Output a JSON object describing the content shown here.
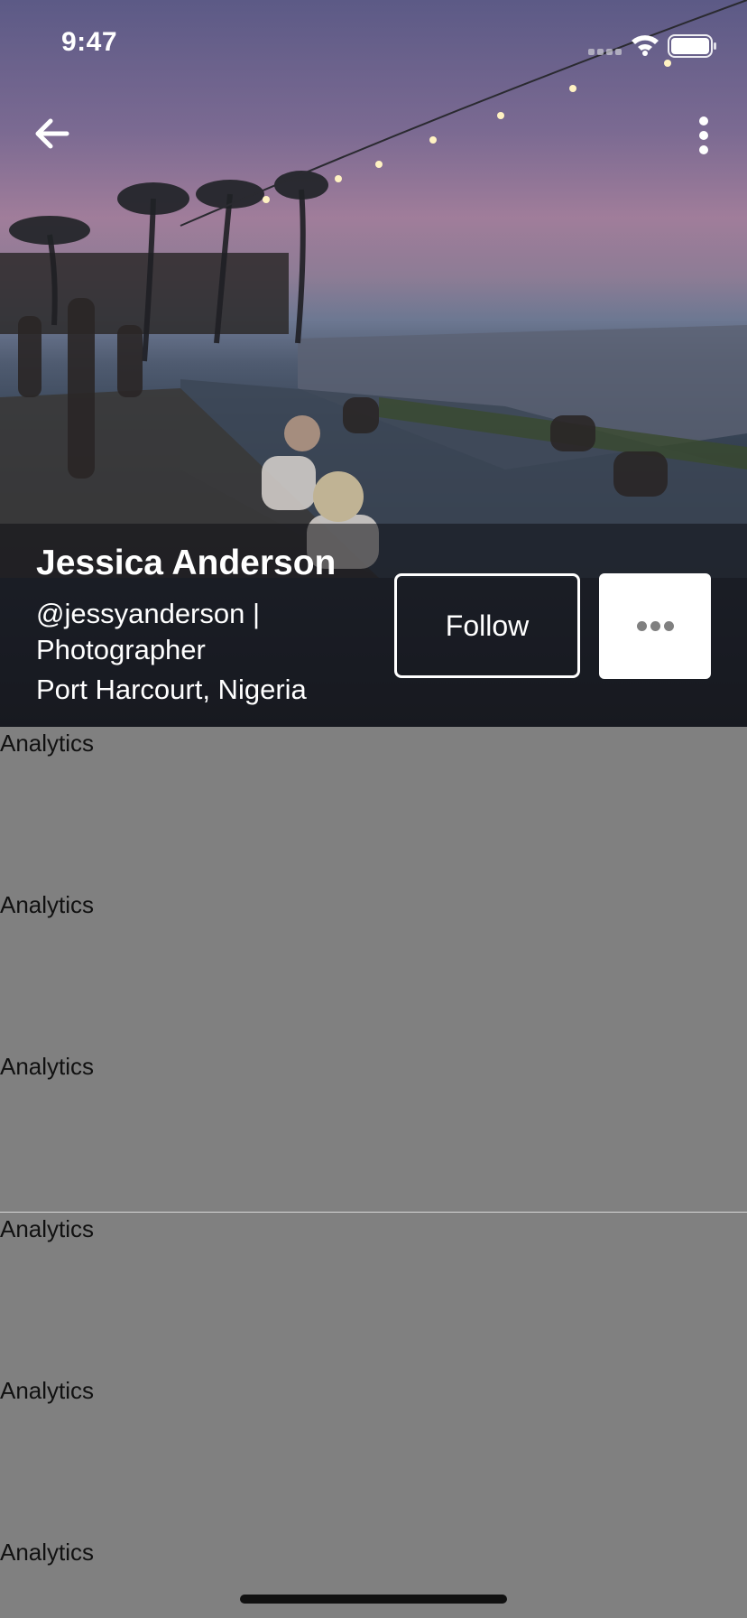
{
  "status_bar": {
    "time": "9:47"
  },
  "profile": {
    "name": "Jessica Anderson",
    "handle_line1": "@jessyanderson |",
    "handle_line2": "Photographer",
    "location": "Port Harcourt, Nigeria"
  },
  "actions": {
    "follow_label": "Follow"
  },
  "analytics": [
    {
      "label": "Analytics"
    },
    {
      "label": "Analytics"
    },
    {
      "label": "Analytics"
    },
    {
      "label": "Analytics"
    },
    {
      "label": "Analytics"
    },
    {
      "label": "Analytics"
    }
  ],
  "icons": {
    "back": "arrow-left-icon",
    "menu": "vertical-ellipsis-icon",
    "more": "horizontal-ellipsis-icon"
  },
  "colors": {
    "background": "#808080",
    "overlay": "#0f0f14",
    "text_light": "#ffffff",
    "text_dark": "#111111"
  }
}
